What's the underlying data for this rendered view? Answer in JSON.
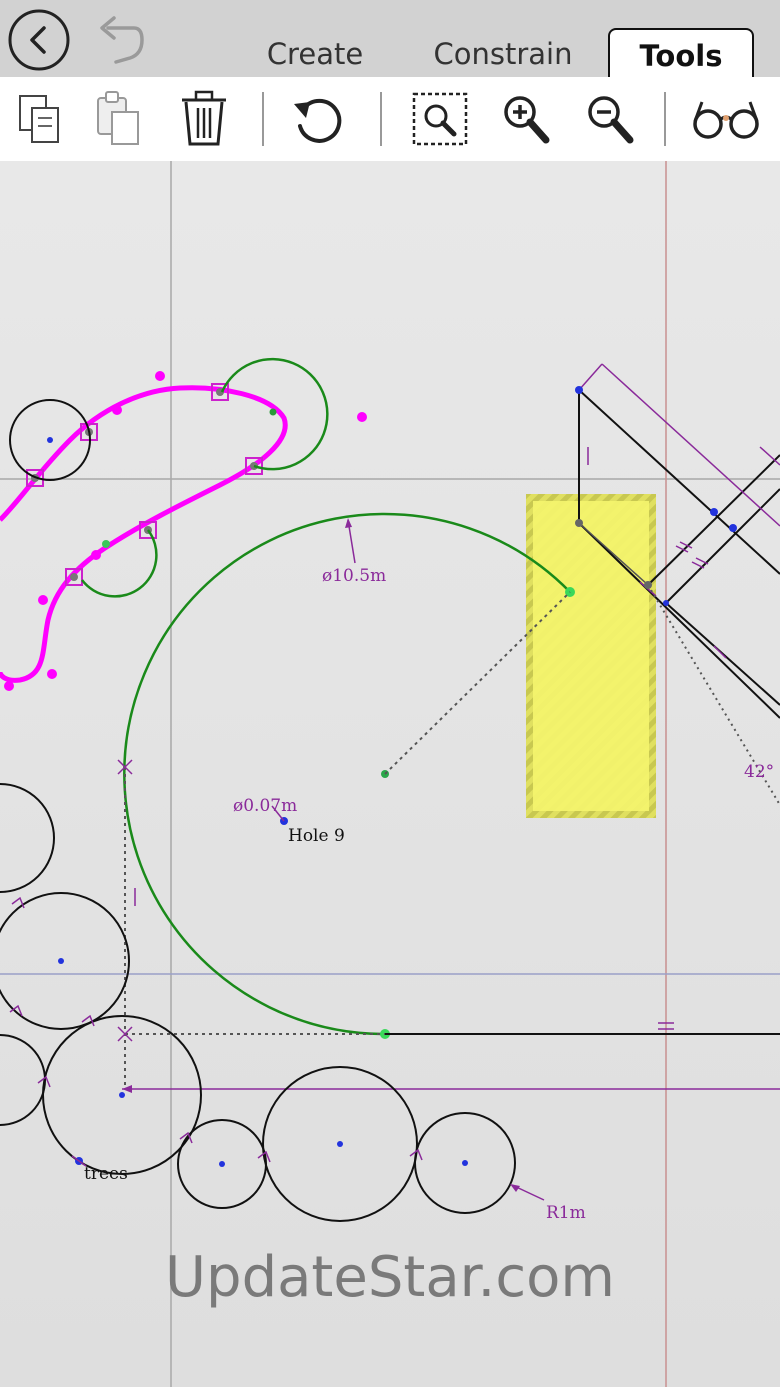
{
  "tabs": [
    {
      "label": "Create",
      "active": false
    },
    {
      "label": "Constrain",
      "active": false
    },
    {
      "label": "Tools",
      "active": true
    }
  ],
  "toolbar": {
    "icons": [
      "copy-icon",
      "paste-icon",
      "trash-icon",
      "undo-rotate-icon",
      "zoom-fit-icon",
      "zoom-in-icon",
      "zoom-out-icon",
      "glasses-icon"
    ]
  },
  "drawing": {
    "labels": {
      "diameter_large": "ø10.5m",
      "diameter_small": "ø0.07m",
      "hole": "Hole 9",
      "angle": "42°",
      "radius": "R1m",
      "trees": "trees"
    }
  },
  "watermark": "UpdateStar.com",
  "colors": {
    "accent_magenta": "#ff00ff",
    "constraint_purple": "#8a2a9a",
    "arc_green": "#1a8a1a",
    "highlight_yellow": "#f5f56e"
  }
}
